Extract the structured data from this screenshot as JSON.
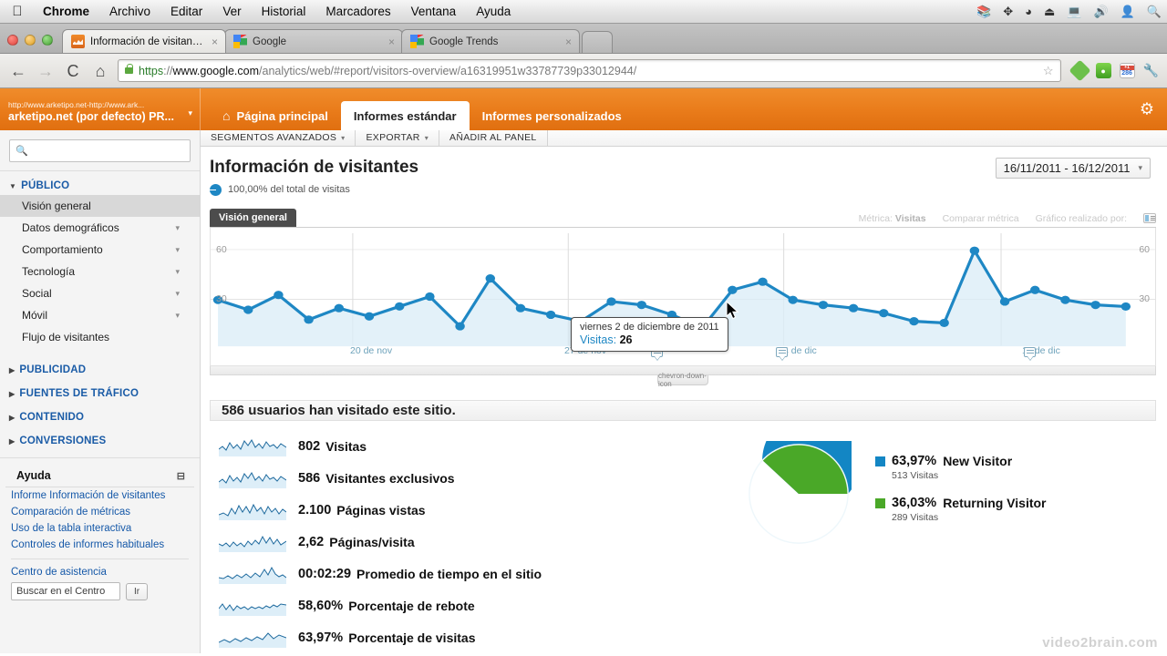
{
  "os_menubar": {
    "apple_icon": "apple-logo",
    "items": [
      {
        "label": "Chrome",
        "bold": true
      },
      {
        "label": "Archivo",
        "bold": false
      },
      {
        "label": "Editar",
        "bold": false
      },
      {
        "label": "Ver",
        "bold": false
      },
      {
        "label": "Historial",
        "bold": false
      },
      {
        "label": "Marcadores",
        "bold": false
      },
      {
        "label": "Ventana",
        "bold": false
      },
      {
        "label": "Ayuda",
        "bold": false
      }
    ],
    "status_icons": [
      "evernote-icon",
      "bluetooth-icon",
      "wifi-icon",
      "eject-icon",
      "display-icon",
      "volume-icon",
      "user-icon",
      "spotlight-search-icon"
    ]
  },
  "browser": {
    "tabs": [
      {
        "title": "Información de visitantes – C",
        "favicon": "analytics-icon",
        "active": true,
        "close": "×"
      },
      {
        "title": "Google",
        "favicon": "google-icon",
        "active": false,
        "close": "×"
      },
      {
        "title": "Google Trends",
        "favicon": "google-icon",
        "active": false,
        "close": "×"
      }
    ],
    "nav": {
      "back": "←",
      "forward": "→",
      "reload": "C",
      "home": "⌂"
    },
    "url": {
      "scheme": "https",
      "separator": "://",
      "host": "www.google.com",
      "path": "/analytics/web/#report/visitors-overview/a16319951w33787739p33012944/",
      "lock_icon": "lock-icon"
    },
    "star_icon": "bookmark-star-icon",
    "extensions": [
      {
        "name": "feedly-icon"
      },
      {
        "name": "evernote-icon"
      },
      {
        "name": "calendar-icon",
        "badge": "286",
        "plus": "+1"
      }
    ],
    "menu_icon": "wrench-menu-icon"
  },
  "ga_header": {
    "account_top": "http://www.arketipo.net-http://www.ark...",
    "account_main": "arketipo.net (por defecto) PR...",
    "account_caret": "▾",
    "tabs": [
      {
        "label": "Página principal",
        "icon": "home-icon",
        "active": false
      },
      {
        "label": "Informes estándar",
        "icon": "",
        "active": true
      },
      {
        "label": "Informes personalizados",
        "icon": "",
        "active": false
      }
    ],
    "settings_icon": "gear-icon"
  },
  "sidebar": {
    "search_placeholder": "",
    "search_icon": "search-icon",
    "groups": [
      {
        "label": "PÚBLICO",
        "expanded": true,
        "items": [
          {
            "label": "Visión general",
            "selected": true,
            "chevron": false
          },
          {
            "label": "Datos demográficos",
            "selected": false,
            "chevron": true
          },
          {
            "label": "Comportamiento",
            "selected": false,
            "chevron": true
          },
          {
            "label": "Tecnología",
            "selected": false,
            "chevron": true
          },
          {
            "label": "Social",
            "selected": false,
            "chevron": true
          },
          {
            "label": "Móvil",
            "selected": false,
            "chevron": true
          },
          {
            "label": "Flujo de visitantes",
            "selected": false,
            "chevron": false
          }
        ]
      },
      {
        "label": "PUBLICIDAD",
        "expanded": false,
        "items": []
      },
      {
        "label": "FUENTES DE TRÁFICO",
        "expanded": false,
        "items": []
      },
      {
        "label": "CONTENIDO",
        "expanded": false,
        "items": []
      },
      {
        "label": "CONVERSIONES",
        "expanded": false,
        "items": []
      }
    ],
    "help": {
      "title": "Ayuda",
      "collapse_icon": "minimize-icon",
      "links": [
        "Informe Información de visitantes",
        "Comparación de métricas",
        "Uso de la tabla interactiva",
        "Controles de informes habituales"
      ],
      "center_label": "Centro de asistencia",
      "search_value": "Buscar en el Centro",
      "go_label": "Ir"
    }
  },
  "report": {
    "toolbar": [
      {
        "label": "SEGMENTOS AVANZADOS",
        "caret": "▾"
      },
      {
        "label": "EXPORTAR",
        "caret": "▾"
      },
      {
        "label": "AÑADIR AL PANEL",
        "caret": ""
      }
    ],
    "title": "Información de visitantes",
    "segment_text": "100,00% del total de visitas",
    "segment_icon": "pie-segment-icon",
    "date_range": "16/11/2011 - 16/12/2011",
    "date_caret": "▾",
    "chart_tab": "Visión general",
    "chart_meta": {
      "metric_label": "Métrica:",
      "metric_value": "Visitas",
      "compare_label": "Comparar métrica",
      "graph_by_label": "Gráfico realizado por:",
      "graph_by_icon": "graph-type-icon"
    },
    "expand_icon": "chevron-down-icon",
    "tooltip": {
      "date": "viernes 2 de diciembre de 2011",
      "metric_label": "Visitas:",
      "metric_value": "26"
    },
    "summary_headline": "586 usuarios han visitado este sitio.",
    "metrics": [
      {
        "value": "802",
        "label": "Visitas"
      },
      {
        "value": "586",
        "label": "Visitantes exclusivos"
      },
      {
        "value": "2.100",
        "label": "Páginas vistas"
      },
      {
        "value": "2,62",
        "label": "Páginas/visita"
      },
      {
        "value": "00:02:29",
        "label": "Promedio de tiempo en el sitio"
      },
      {
        "value": "58,60%",
        "label": "Porcentaje de rebote"
      },
      {
        "value": "63,97%",
        "label": "Porcentaje de visitas"
      }
    ],
    "pie_legend": [
      {
        "percent": "63,97%",
        "name": "New Visitor",
        "sub": "513 Visitas",
        "color": "#1386c4"
      },
      {
        "percent": "36,03%",
        "name": "Returning Visitor",
        "sub": "289 Visitas",
        "color": "#4aa828"
      }
    ]
  },
  "watermark": "video2brain.com",
  "colors": {
    "ga_orange": "#e97b1a",
    "line_blue": "#1e87c4",
    "pie_blue": "#1386c4",
    "pie_green": "#4aa828",
    "link_blue": "#1558a8"
  },
  "chart_data": {
    "type": "line",
    "title": "Visión general",
    "xlabel": "",
    "ylabel": "Visitas",
    "ylim": [
      0,
      70
    ],
    "yticks": [
      30,
      60
    ],
    "grid": true,
    "legend_position": "none",
    "x_tick_labels": [
      "20 de nov",
      "27 de nov",
      "4 de dic",
      "11 de dic"
    ],
    "x_tick_indices": [
      4,
      11,
      18,
      25
    ],
    "x": [
      "16 nov",
      "17 nov",
      "18 nov",
      "19 nov",
      "20 nov",
      "21 nov",
      "22 nov",
      "23 nov",
      "24 nov",
      "25 nov",
      "26 nov",
      "27 nov",
      "28 nov",
      "29 nov",
      "30 nov",
      "1 dic",
      "2 dic",
      "3 dic",
      "4 dic",
      "5 dic",
      "6 dic",
      "7 dic",
      "8 dic",
      "9 dic",
      "10 dic",
      "11 dic",
      "12 dic",
      "13 dic",
      "14 dic",
      "15 dic",
      "16 dic"
    ],
    "series": [
      {
        "name": "Visitas",
        "color": "#1e87c4",
        "values": [
          28,
          22,
          31,
          16,
          23,
          18,
          24,
          30,
          18,
          47,
          29,
          25,
          21,
          33,
          31,
          26,
          18,
          41,
          46,
          33,
          30,
          28,
          25,
          20,
          19,
          58,
          27,
          34,
          28,
          25,
          24
        ]
      }
    ],
    "highlight_point": {
      "x": "2 dic",
      "value": 26,
      "label": "viernes 2 de diciembre de 2011"
    },
    "annotations_at": [
      "24 nov",
      "4 dic",
      "11 dic"
    ]
  },
  "pie_chart_data": {
    "type": "pie",
    "title": "",
    "labels": [
      "New Visitor",
      "Returning Visitor"
    ],
    "values": [
      63.97,
      36.03
    ],
    "counts": [
      513,
      289
    ],
    "colors": [
      "#1386c4",
      "#4aa828"
    ]
  }
}
